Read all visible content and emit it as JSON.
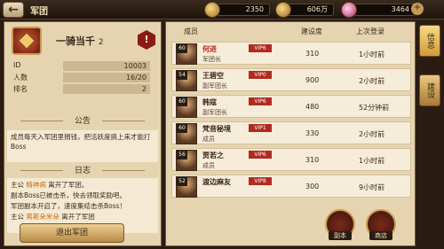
{
  "header": {
    "title": "军团",
    "back_icon": "back-arrow-icon",
    "resources": [
      {
        "icon": "copper-coin-icon",
        "value": "2350"
      },
      {
        "icon": "gold-ingot-icon",
        "value": "606万"
      },
      {
        "icon": "gem-icon",
        "value": "3464"
      }
    ]
  },
  "legion": {
    "name": "一骑当千",
    "level": "2",
    "stats": [
      {
        "label": "ID",
        "value": "10003"
      },
      {
        "label": "人数",
        "value": "16/20"
      },
      {
        "label": "排名",
        "value": "2"
      }
    ],
    "notice_title": "公告",
    "notice": "成员每天入军团里捐钱，把活跃度搞上来才能打Boss",
    "log_title": "日志",
    "log": [
      {
        "pre": "主公 ",
        "name": "精神病",
        "post": " 离开了军团。"
      },
      {
        "pre": "副本Boss已被击杀，快去领取奖励吧。",
        "name": "",
        "post": ""
      },
      {
        "pre": "军团副本开启了，速度集结击杀Boss！",
        "name": "",
        "post": ""
      },
      {
        "pre": "主公 ",
        "name": "蒋斯朵米朵",
        "post": " 离开了军团"
      }
    ],
    "quit_label": "退出军团"
  },
  "members": {
    "columns": {
      "member": "成员",
      "contribution": "建设度",
      "last_login": "上次登录"
    },
    "rows": [
      {
        "level": "60",
        "name": "何进",
        "vip": "VIP6",
        "role": "军团长",
        "contribution": "310",
        "last_login": "1小时前",
        "leader": true
      },
      {
        "level": "54",
        "name": "王碧空",
        "vip": "VIP0",
        "role": "副军团长",
        "contribution": "900",
        "last_login": "2小时前",
        "leader": false
      },
      {
        "level": "60",
        "name": "韩寇",
        "vip": "VIP6",
        "role": "副军团长",
        "contribution": "480",
        "last_login": "52分钟前",
        "leader": false
      },
      {
        "level": "60",
        "name": "梵音秘境",
        "vip": "VIP1",
        "role": "成员",
        "contribution": "330",
        "last_login": "2小时前",
        "leader": false
      },
      {
        "level": "56",
        "name": "贾若之",
        "vip": "VIP6",
        "role": "成员",
        "contribution": "310",
        "last_login": "1小时前",
        "leader": false
      },
      {
        "level": "52",
        "name": "渡边麻友",
        "vip": "VIP8",
        "role": "",
        "contribution": "300",
        "last_login": "9小时前",
        "leader": false
      }
    ]
  },
  "side_tabs": [
    {
      "label": "信息",
      "active": true
    },
    {
      "label": "建设",
      "active": false
    }
  ],
  "bottom_buttons": [
    {
      "label": "副本",
      "icon": "dungeon-icon"
    },
    {
      "label": "商店",
      "icon": "shop-icon"
    }
  ]
}
